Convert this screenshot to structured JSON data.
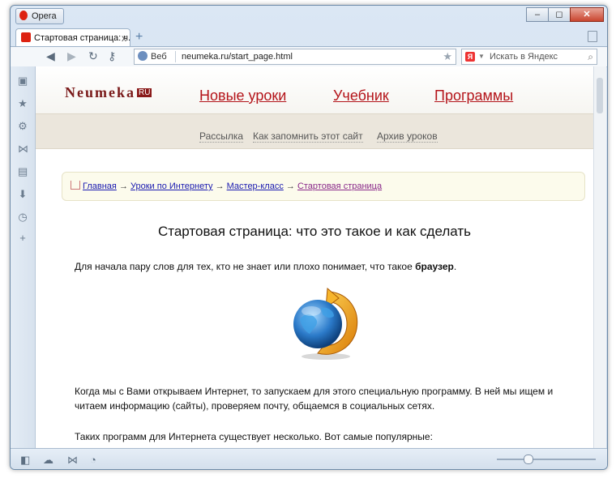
{
  "browser": {
    "app_label": "Opera",
    "window_buttons": [
      "–",
      "◻",
      "✕"
    ],
    "tab": {
      "title": "Стартовая страница: ч...",
      "close": "x"
    },
    "newtab": "+",
    "address": {
      "mode": "Веб",
      "url": "neumeka.ru/start_page.html"
    },
    "search": {
      "engine_badge": "Я",
      "placeholder": "Искать в Яндекс"
    },
    "zoom_level": 0.27
  },
  "site": {
    "logo": "Neumeka",
    "logo_suffix": "RU",
    "nav": [
      "Новые уроки",
      "Учебник",
      "Программы"
    ],
    "subnav": [
      "Рассылка",
      "Как запомнить этот сайт",
      "Архив уроков"
    ],
    "breadcrumbs": [
      "Главная",
      "Уроки по Интернету",
      "Мастер-класс",
      "Стартовая страница"
    ],
    "crumb_sep": "→",
    "title": "Стартовая страница: что это такое и как сделать",
    "intro_text": "Для начала пару слов для тех, кто не знает или плохо понимает, что такое ",
    "intro_bold": "браузер",
    "intro_end": ".",
    "para2": "Когда мы с Вами открываем Интернет, то запускаем для этого специальную программу. В ней мы ищем и читаем информацию (сайты), проверяем почту, общаемся в социальных сетях.",
    "para3": "Таких программ для Интернета существует несколько. Вот самые популярные:"
  }
}
